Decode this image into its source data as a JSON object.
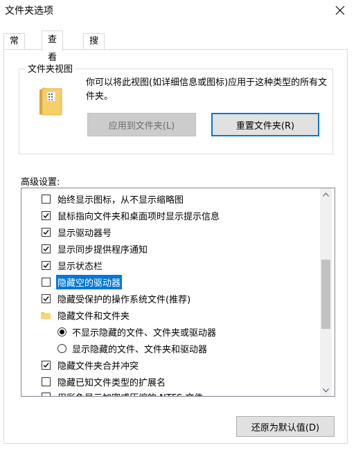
{
  "window": {
    "title": "文件夹选项",
    "close_icon": "close-icon"
  },
  "tabs": [
    {
      "label": "常规",
      "active": false
    },
    {
      "label": "查看",
      "active": true
    },
    {
      "label": "搜索",
      "active": false
    }
  ],
  "folder_views": {
    "group_title": "文件夹视图",
    "description": "你可以将此视图(如详细信息或图标)应用于这种类型的所有文件夹。",
    "apply_label": "应用到文件夹(L)",
    "reset_label": "重置文件夹(R)"
  },
  "advanced": {
    "label": "高级设置:",
    "items": [
      {
        "type": "checkbox",
        "checked": false,
        "label": "始终显示图标，从不显示缩略图"
      },
      {
        "type": "checkbox",
        "checked": true,
        "label": "鼠标指向文件夹和桌面项时显示提示信息"
      },
      {
        "type": "checkbox",
        "checked": true,
        "label": "显示驱动器号"
      },
      {
        "type": "checkbox",
        "checked": true,
        "label": "显示同步提供程序通知"
      },
      {
        "type": "checkbox",
        "checked": true,
        "label": "显示状态栏"
      },
      {
        "type": "checkbox",
        "checked": false,
        "label": "隐藏空的驱动器",
        "selected": true
      },
      {
        "type": "checkbox",
        "checked": true,
        "label": "隐藏受保护的操作系统文件(推荐)"
      },
      {
        "type": "folder",
        "label": "隐藏文件和文件夹"
      },
      {
        "type": "radio",
        "checked": true,
        "label": "不显示隐藏的文件、文件夹或驱动器"
      },
      {
        "type": "radio",
        "checked": false,
        "label": "显示隐藏的文件、文件夹和驱动器"
      },
      {
        "type": "checkbox",
        "checked": true,
        "label": "隐藏文件夹合并冲突"
      },
      {
        "type": "checkbox",
        "checked": false,
        "label": "隐藏已知文件类型的扩展名"
      },
      {
        "type": "checkbox",
        "checked": false,
        "label": "用彩色显示加密或压缩的 NTFS 文件"
      }
    ]
  },
  "footer": {
    "restore_label": "还原为默认值(D)"
  }
}
